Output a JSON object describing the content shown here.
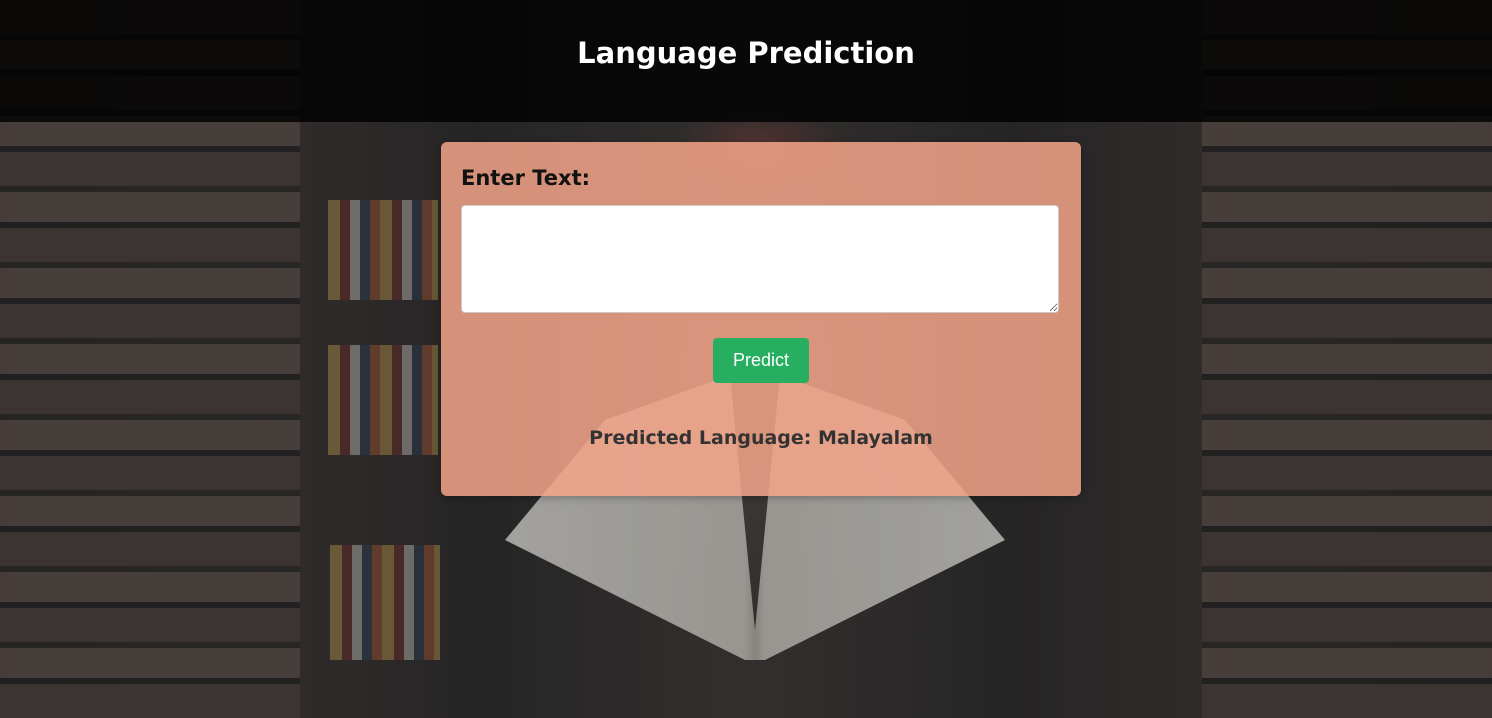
{
  "header": {
    "title": "Language Prediction"
  },
  "form": {
    "input_label": "Enter Text:",
    "input_value": "",
    "predict_label": "Predict"
  },
  "result": {
    "text": "Predicted Language: Malayalam"
  },
  "colors": {
    "header_bg": "#000000",
    "card_bg": "#f4a488",
    "button_bg": "#27ae60"
  }
}
